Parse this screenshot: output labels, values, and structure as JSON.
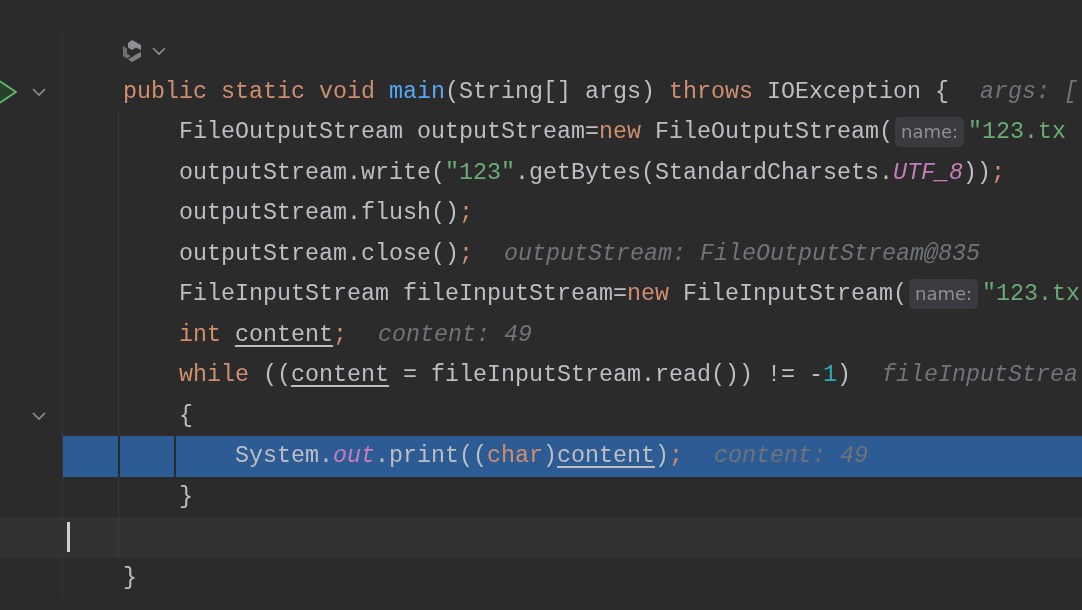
{
  "lines": [
    {
      "kind": "code-vision"
    },
    {
      "kind": "code",
      "runnable": true,
      "expanded": true,
      "current": false,
      "caret": false,
      "tokens": [
        {
          "t": "public static void ",
          "kind": "kw"
        },
        {
          "t": "main",
          "kind": "fn"
        },
        {
          "t": "(String[] args) ",
          "kind": "plain"
        },
        {
          "t": "throws ",
          "kind": "kw"
        },
        {
          "t": "IOException {",
          "kind": "plain"
        },
        {
          "t": "args: [",
          "kind": "hint"
        }
      ],
      "children": [
        {
          "kind": "code",
          "current": false,
          "caret": false,
          "tokens": [
            {
              "t": "FileOutputStream outputStream=",
              "kind": "plain"
            },
            {
              "t": "new ",
              "kind": "kw"
            },
            {
              "t": "FileOutputStream(",
              "kind": "plain"
            },
            {
              "t": "name:",
              "kind": "param"
            },
            {
              "t": "\"123.tx",
              "kind": "str"
            }
          ]
        },
        {
          "kind": "code",
          "current": false,
          "caret": false,
          "tokens": [
            {
              "t": "outputStream.write(",
              "kind": "plain"
            },
            {
              "t": "\"123\"",
              "kind": "str"
            },
            {
              "t": ".getBytes(StandardCharsets.",
              "kind": "plain"
            },
            {
              "t": "UTF_8",
              "kind": "static"
            },
            {
              "t": "))",
              "kind": "plain"
            },
            {
              "t": ";",
              "kind": "kw"
            }
          ]
        },
        {
          "kind": "code",
          "current": false,
          "caret": false,
          "tokens": [
            {
              "t": "outputStream.flush()",
              "kind": "plain"
            },
            {
              "t": ";",
              "kind": "kw"
            }
          ]
        },
        {
          "kind": "code",
          "current": false,
          "caret": false,
          "tokens": [
            {
              "t": "outputStream.close()",
              "kind": "plain"
            },
            {
              "t": ";",
              "kind": "kw"
            },
            {
              "t": "outputStream: FileOutputStream@835",
              "kind": "hint"
            }
          ]
        },
        {
          "kind": "code",
          "current": false,
          "caret": false,
          "tokens": [
            {
              "t": "FileInputStream fileInputStream=",
              "kind": "plain"
            },
            {
              "t": "new ",
              "kind": "kw"
            },
            {
              "t": "FileInputStream(",
              "kind": "plain"
            },
            {
              "t": "name:",
              "kind": "param"
            },
            {
              "t": "\"123.tx",
              "kind": "str"
            }
          ]
        },
        {
          "kind": "code",
          "current": false,
          "caret": false,
          "tokens": [
            {
              "t": "int ",
              "kind": "kw"
            },
            {
              "t": "content",
              "kind": "var"
            },
            {
              "t": ";",
              "kind": "kw"
            },
            {
              "t": "content: 49",
              "kind": "hint"
            }
          ]
        },
        {
          "kind": "code",
          "current": false,
          "caret": false,
          "tokens": [
            {
              "t": "while ",
              "kind": "kw"
            },
            {
              "t": "((",
              "kind": "plain"
            },
            {
              "t": "content",
              "kind": "var"
            },
            {
              "t": " = fileInputStream.read()) != -",
              "kind": "plain"
            },
            {
              "t": "1",
              "kind": "num"
            },
            {
              "t": ")",
              "kind": "plain"
            },
            {
              "t": "fileInputStrea",
              "kind": "hint"
            }
          ]
        },
        {
          "kind": "code",
          "expanded": true,
          "current": false,
          "caret": false,
          "tokens": [
            {
              "t": "{",
              "kind": "plain"
            }
          ],
          "children": [
            {
              "kind": "code",
              "current": true,
              "caret": false,
              "tokens": [
                {
                  "t": "System.",
                  "kind": "plain"
                },
                {
                  "t": "out",
                  "kind": "static"
                },
                {
                  "t": ".print((",
                  "kind": "plain"
                },
                {
                  "t": "char",
                  "kind": "kw"
                },
                {
                  "t": ")",
                  "kind": "plain"
                },
                {
                  "t": "content",
                  "kind": "var"
                },
                {
                  "t": ")",
                  "kind": "plain"
                },
                {
                  "t": ";",
                  "kind": "kw"
                },
                {
                  "t": "content: 49",
                  "kind": "hint"
                }
              ]
            }
          ]
        },
        {
          "kind": "code",
          "current": false,
          "caret": false,
          "tokens": [
            {
              "t": "}",
              "kind": "plain"
            }
          ]
        },
        {
          "kind": "blank",
          "current": false,
          "caret": true
        }
      ]
    },
    {
      "kind": "code",
      "current": false,
      "caret": false,
      "tokens": [
        {
          "t": "}",
          "kind": "plain"
        }
      ]
    }
  ]
}
